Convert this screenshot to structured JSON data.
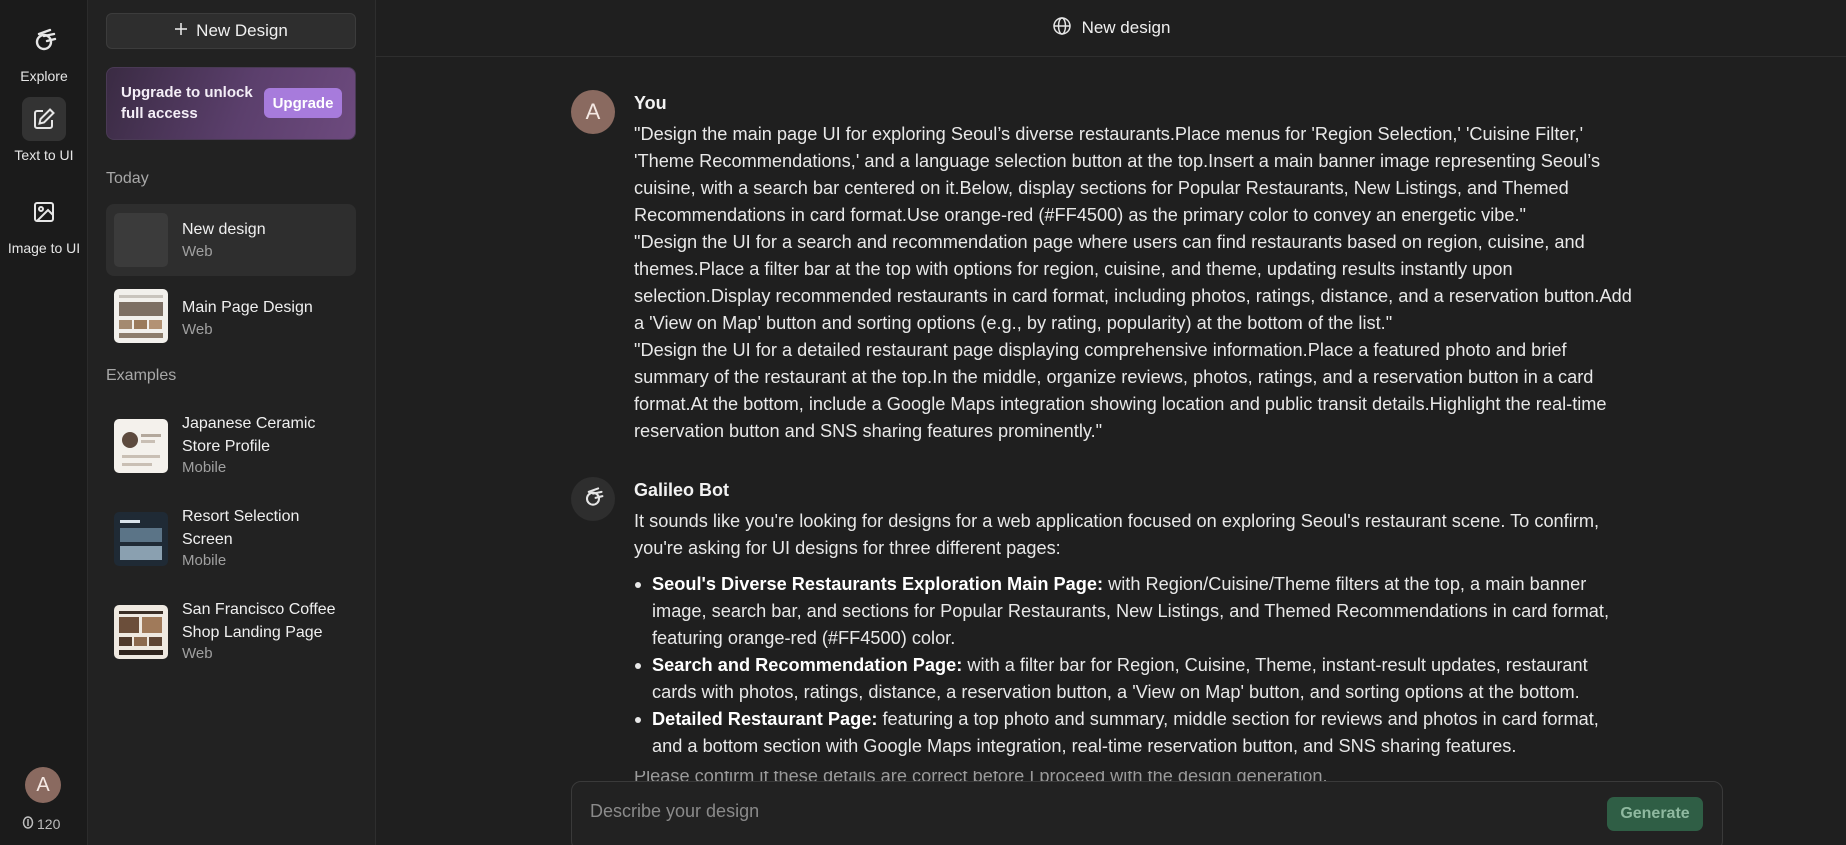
{
  "rail": {
    "items": [
      {
        "label": "Explore",
        "icon": "galileo-logo-icon"
      },
      {
        "label": "Text to UI",
        "icon": "edit-icon"
      },
      {
        "label": "Image to UI",
        "icon": "image-icon"
      }
    ],
    "avatar_initial": "A",
    "credits": "120"
  },
  "sidebar": {
    "new_design_label": "New Design",
    "upgrade_text": "Upgrade to unlock full access",
    "upgrade_button": "Upgrade",
    "today_label": "Today",
    "today_items": [
      {
        "title": "New design",
        "sub": "Web"
      },
      {
        "title": "Main Page Design",
        "sub": "Web"
      }
    ],
    "examples_label": "Examples",
    "example_items": [
      {
        "title": "Japanese Ceramic Store Profile",
        "sub": "Mobile"
      },
      {
        "title": "Resort Selection Screen",
        "sub": "Mobile"
      },
      {
        "title": "San Francisco Coffee Shop Landing Page",
        "sub": "Web"
      }
    ]
  },
  "topbar": {
    "title": "New design"
  },
  "conversation": {
    "user": {
      "initial": "A",
      "name": "You",
      "paragraphs": [
        "\"Design the main page UI for exploring Seoul’s diverse restaurants.Place menus for 'Region Selection,' 'Cuisine Filter,' 'Theme Recommendations,' and a language selection button at the top.Insert a main banner image representing Seoul’s cuisine, with a search bar centered on it.Below, display sections for Popular Restaurants, New Listings, and Themed Recommendations in card format.Use orange-red (#FF4500) as the primary color to convey an energetic vibe.\"",
        "\"Design the UI for a search and recommendation page where users can find restaurants based on region, cuisine, and themes.Place a filter bar at the top with options for region, cuisine, and theme, updating results instantly upon selection.Display recommended restaurants in card format, including photos, ratings, distance, and a reservation button.Add a 'View on Map' button and sorting options (e.g., by rating, popularity) at the bottom of the list.\"",
        "\"Design the UI for a detailed restaurant page displaying comprehensive information.Place a featured photo and brief summary of the restaurant at the top.In the middle, organize reviews, photos, ratings, and a reservation button in a card format.At the bottom, include a Google Maps integration showing location and public transit details.Highlight the real-time reservation button and SNS sharing features prominently.\""
      ]
    },
    "bot": {
      "name": "Galileo Bot",
      "intro": "It sounds like you're looking for designs for a web application focused on exploring Seoul's restaurant scene. To confirm, you're asking for UI designs for three different pages:",
      "bullets": [
        {
          "bold": "Seoul's Diverse Restaurants Exploration Main Page:",
          "text": " with Region/Cuisine/Theme filters at the top, a main banner image, search bar, and sections for Popular Restaurants, New Listings, and Themed Recommendations in card format, featuring orange-red (#FF4500) color."
        },
        {
          "bold": "Search and Recommendation Page:",
          "text": " with a filter bar for Region, Cuisine, Theme, instant-result updates, restaurant cards with photos, ratings, distance, a reservation button, a 'View on Map' button, and sorting options at the bottom."
        },
        {
          "bold": "Detailed Restaurant Page:",
          "text": " featuring a top photo and summary, middle section for reviews and photos in card format, and a bottom section with Google Maps integration, real-time reservation button, and SNS sharing features."
        }
      ],
      "trailing": "Please confirm if these details are correct before I proceed with the design generation."
    }
  },
  "composer": {
    "placeholder": "Describe your design",
    "generate_label": "Generate"
  },
  "colors": {
    "background": "#1f1f1f",
    "upgrade_accent": "#a77bdc",
    "generate_button": "#2f5e45"
  }
}
